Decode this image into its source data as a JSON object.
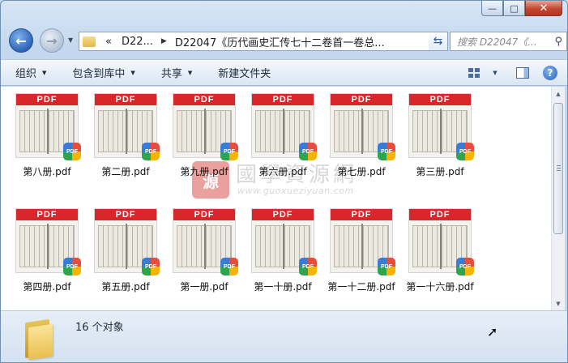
{
  "window": {
    "caption": {
      "minimize": "—",
      "maximize": "□",
      "close": "✕"
    }
  },
  "nav": {
    "back_icon": "back-arrow-icon",
    "forward_icon": "forward-arrow-icon",
    "breadcrumb": [
      "«",
      "D22...",
      "D22047《历代画史汇传七十二卷首一卷总..."
    ],
    "search_placeholder": "搜索 D22047《...",
    "refresh_icon": "refresh-icon"
  },
  "toolbar": {
    "items": [
      "组织",
      "包含到库中",
      "共享",
      "新建文件夹"
    ],
    "icons": [
      "view-options-icon",
      "preview-pane-icon",
      "help-icon"
    ]
  },
  "files": [
    {
      "name": "第八册.pdf"
    },
    {
      "name": "第二册.pdf"
    },
    {
      "name": "第九册.pdf"
    },
    {
      "name": "第六册.pdf"
    },
    {
      "name": "第七册.pdf"
    },
    {
      "name": "第三册.pdf"
    },
    {
      "name": "第四册.pdf"
    },
    {
      "name": "第五册.pdf"
    },
    {
      "name": "第一册.pdf"
    },
    {
      "name": "第一十册.pdf"
    },
    {
      "name": "第一十二册.pdf"
    },
    {
      "name": "第一十六册.pdf"
    }
  ],
  "thumb_band": "PDF",
  "badge_text": "PDF",
  "watermark": {
    "seal": "源",
    "chinese": "國學資源網",
    "url": "www.guoxueziyuan.com"
  },
  "status": {
    "count": "16 个对象"
  },
  "colors": {
    "pdf_band": "#d8262b",
    "selection_blue": "#2e63b8"
  }
}
